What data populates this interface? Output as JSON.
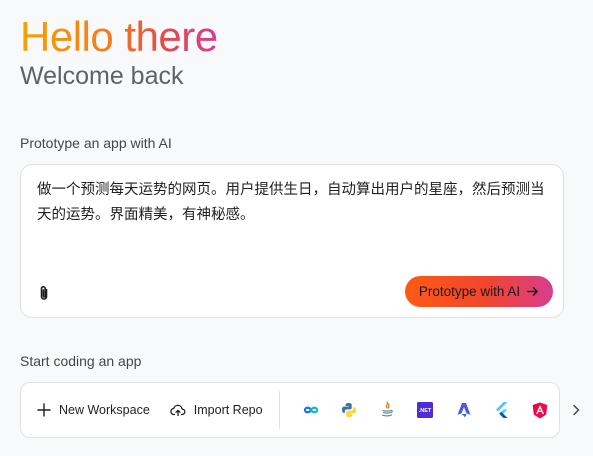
{
  "hero": {
    "title": "Hello there",
    "subtitle": "Welcome back"
  },
  "prototype": {
    "label": "Prototype an app with AI",
    "prompt_text": "做一个预测每天运势的网页。用户提供生日，自动算出用户的星座，然后预测当天的运势。界面精美，有神秘感。",
    "button_label": "Prototype with AI"
  },
  "start_coding": {
    "label": "Start coding an app",
    "new_workspace_label": "New Workspace",
    "import_repo_label": "Import Repo",
    "templates": [
      {
        "name": "Project IDX",
        "icon": "infinity-icon"
      },
      {
        "name": "Python",
        "icon": "python-icon"
      },
      {
        "name": "Java",
        "icon": "java-icon"
      },
      {
        "name": ".NET",
        "icon": "dotnet-icon",
        "text": ".NET"
      },
      {
        "name": "Astro",
        "icon": "astro-icon"
      },
      {
        "name": "Flutter",
        "icon": "flutter-icon"
      },
      {
        "name": "Angular",
        "icon": "angular-icon"
      }
    ]
  },
  "colors": {
    "gradient": [
      "#f6a300",
      "#f47c1c",
      "#e5484d",
      "#d63e91"
    ],
    "cta_gradient": [
      "#ff5a14",
      "#f2452f",
      "#d83d8d"
    ]
  }
}
